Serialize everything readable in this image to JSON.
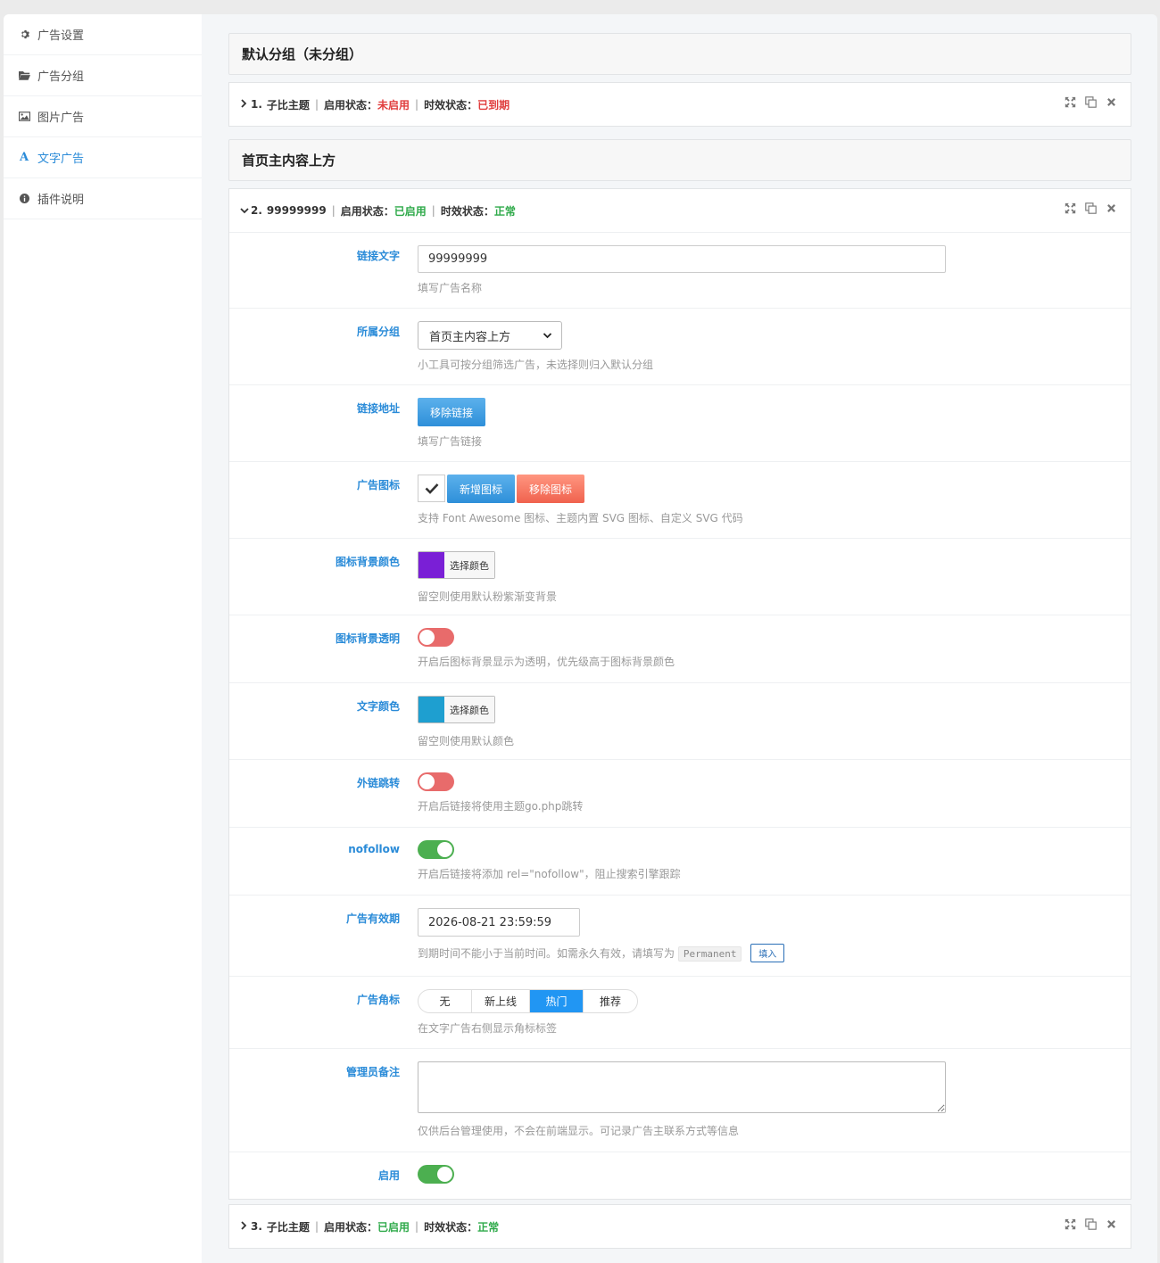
{
  "sidebar": {
    "items": [
      {
        "label": "广告设置",
        "icon": "gear-icon"
      },
      {
        "label": "广告分组",
        "icon": "folder-icon"
      },
      {
        "label": "图片广告",
        "icon": "image-icon"
      },
      {
        "label": "文字广告",
        "icon": "font-icon",
        "active": true
      },
      {
        "label": "插件说明",
        "icon": "info-icon"
      }
    ]
  },
  "groups": [
    {
      "title": "默认分组（未分组）"
    },
    {
      "title": "首页主内容上方"
    }
  ],
  "items": [
    {
      "index": "1.",
      "name": "子比主题",
      "enable_label": "启用状态：",
      "enable_value": "未启用",
      "time_label": "时效状态：",
      "time_value": "已到期",
      "expanded": false
    },
    {
      "index": "2.",
      "name": "99999999",
      "enable_label": "启用状态：",
      "enable_value": "已启用",
      "time_label": "时效状态：",
      "time_value": "正常",
      "expanded": true
    },
    {
      "index": "3.",
      "name": "子比主题",
      "enable_label": "启用状态：",
      "enable_value": "已启用",
      "time_label": "时效状态：",
      "time_value": "正常",
      "expanded": false
    }
  ],
  "form": {
    "link_text": {
      "label": "链接文字",
      "value": "99999999",
      "help": "填写广告名称"
    },
    "group": {
      "label": "所属分组",
      "value": "首页主内容上方",
      "help": "小工具可按分组筛选广告，未选择则归入默认分组"
    },
    "link_url": {
      "label": "链接地址",
      "button": "移除链接",
      "help": "填写广告链接"
    },
    "ad_icon": {
      "label": "广告图标",
      "add_button": "新增图标",
      "remove_button": "移除图标",
      "help": "支持 Font Awesome 图标、主题内置 SVG 图标、自定义 SVG 代码"
    },
    "icon_bg_color": {
      "label": "图标背景颜色",
      "button": "选择颜色",
      "color": "#7a1fd6",
      "help": "留空则使用默认粉紫渐变背景"
    },
    "icon_bg_transparent": {
      "label": "图标背景透明",
      "on": false,
      "help": "开启后图标背景显示为透明，优先级高于图标背景颜色"
    },
    "text_color": {
      "label": "文字颜色",
      "button": "选择颜色",
      "color": "#1e9fd0",
      "help": "留空则使用默认颜色"
    },
    "external_jump": {
      "label": "外链跳转",
      "on": false,
      "help": "开启后链接将使用主题go.php跳转"
    },
    "nofollow": {
      "label": "nofollow",
      "on": true,
      "help": "开启后链接将添加 rel=\"nofollow\"，阻止搜索引擎跟踪"
    },
    "expiry": {
      "label": "广告有效期",
      "value": "2026-08-21 23:59:59",
      "help_prefix": "到期时间不能小于当前时间。如需永久有效，请填写为",
      "permanent": "Permanent",
      "fill_button": "填入"
    },
    "badge": {
      "label": "广告角标",
      "options": [
        "无",
        "新上线",
        "热门",
        "推荐"
      ],
      "selected": "热门",
      "help": "在文字广告右侧显示角标标签"
    },
    "admin_note": {
      "label": "管理员备注",
      "value": "",
      "help": "仅供后台管理使用，不会在前端显示。可记录广告主联系方式等信息"
    },
    "enabled": {
      "label": "启用",
      "on": true
    }
  }
}
